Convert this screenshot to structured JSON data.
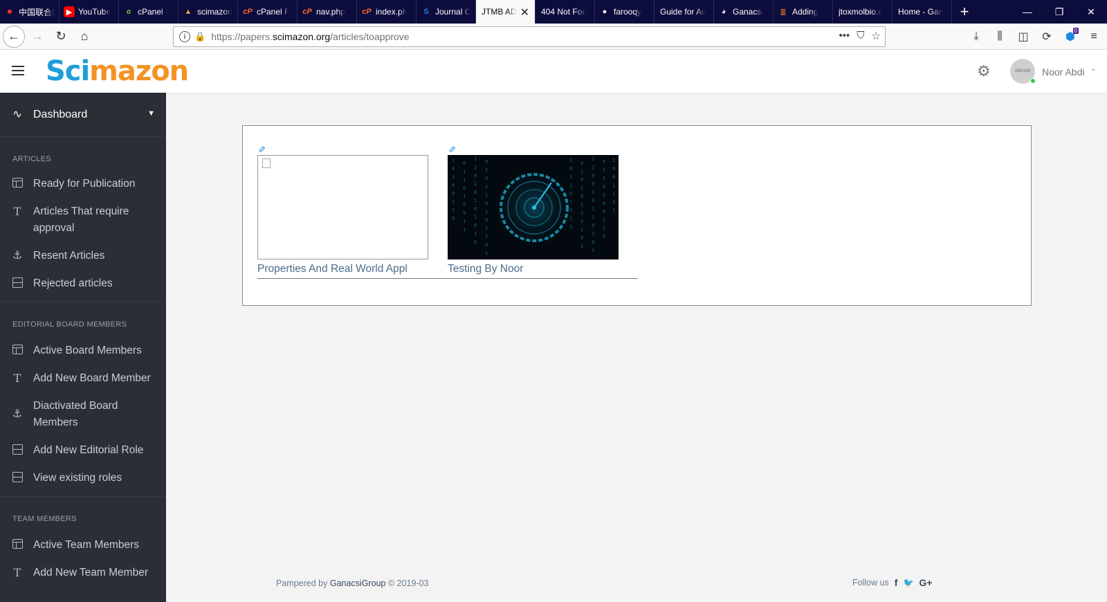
{
  "browser": {
    "tabs": [
      {
        "label": "中国联合网络",
        "icon": "flag-icon",
        "active": false
      },
      {
        "label": "YouTube",
        "icon": "youtube-icon",
        "active": false
      },
      {
        "label": "cPanel -",
        "icon": "cpanel-green-icon",
        "active": false
      },
      {
        "label": "scimazon",
        "icon": "mountain-icon",
        "active": false
      },
      {
        "label": "cPanel F",
        "icon": "cpanel-icon",
        "active": false
      },
      {
        "label": "nav.php",
        "icon": "cpanel-icon",
        "active": false
      },
      {
        "label": "index.ph",
        "icon": "cpanel-icon",
        "active": false
      },
      {
        "label": "Journal C",
        "icon": "s-icon",
        "active": false
      },
      {
        "label": "JTMB AD",
        "icon": "",
        "active": true
      },
      {
        "label": "404 Not Fou",
        "icon": "",
        "active": false
      },
      {
        "label": "farooqy",
        "icon": "github-icon",
        "active": false
      },
      {
        "label": "Guide for Au",
        "icon": "",
        "active": false
      },
      {
        "label": "Ganacsi",
        "icon": "globe-icon",
        "active": false
      },
      {
        "label": "Adding",
        "icon": "stackoverflow-icon",
        "active": false
      },
      {
        "label": "jtoxmolbio.c",
        "icon": "",
        "active": false
      },
      {
        "label": "Home - Gan",
        "icon": "",
        "active": false
      }
    ],
    "url_prefix": "https://papers.",
    "url_host": "scimazon.org",
    "url_path": "/articles/toapprove",
    "extension_badge": "0"
  },
  "header": {
    "logo_part1": "Sci",
    "logo_part2": "mazon",
    "avatar_text": "150x150",
    "user_name": "Noor Abdi"
  },
  "sidebar": {
    "dashboard_label": "Dashboard",
    "sections": [
      {
        "title": "ARTICLES",
        "items": [
          {
            "label": "Ready for Publication",
            "icon": "table-icon"
          },
          {
            "label": "Articles That require approval",
            "icon": "text-icon"
          },
          {
            "label": "Resent Articles",
            "icon": "anchor-icon"
          },
          {
            "label": "Rejected articles",
            "icon": "server-icon"
          }
        ]
      },
      {
        "title": "EDITORIAL BOARD MEMBERS",
        "items": [
          {
            "label": "Active Board Members",
            "icon": "table-icon"
          },
          {
            "label": "Add New Board Member",
            "icon": "text-icon"
          },
          {
            "label": "Diactivated Board Members",
            "icon": "anchor-icon"
          },
          {
            "label": "Add New Editorial Role",
            "icon": "server-icon"
          },
          {
            "label": "View existing roles",
            "icon": "server-icon"
          }
        ]
      },
      {
        "title": "TEAM MEMBERS",
        "items": [
          {
            "label": "Active Team Members",
            "icon": "table-icon"
          },
          {
            "label": "Add New Team Member",
            "icon": "text-icon"
          }
        ]
      }
    ]
  },
  "articles": [
    {
      "title": "Properties And Real World Appl",
      "image": "broken-image"
    },
    {
      "title": "Testing By Noor",
      "image": "matrix-image"
    }
  ],
  "footer": {
    "pampered_by": "Pampered by",
    "brand": "GanacsiGroup",
    "copyright": "© 2019-03",
    "follow_us": "Follow us",
    "social": [
      "f",
      "🐦",
      "G+"
    ]
  },
  "colors": {
    "sidebar_bg": "#2a2f35",
    "logo_blue": "#1e9fd8",
    "logo_orange": "#f39324",
    "tabstrip_bg": "#0c0c3d"
  }
}
